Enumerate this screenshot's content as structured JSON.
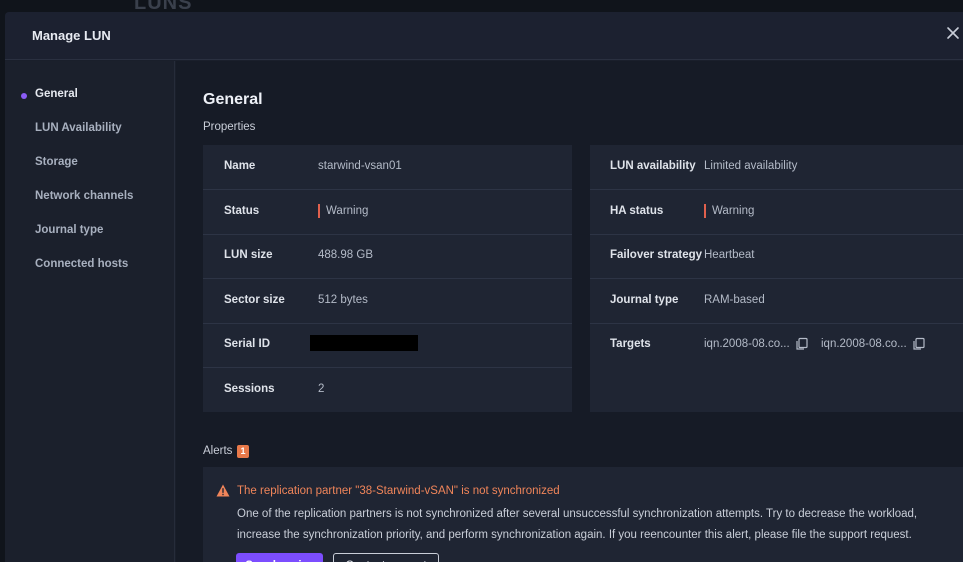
{
  "background": {
    "title": "LUNS"
  },
  "modal": {
    "title": "Manage LUN",
    "close_icon": "close-icon"
  },
  "sidebar": {
    "items": [
      {
        "label": "General",
        "active": true
      },
      {
        "label": "LUN Availability",
        "active": false
      },
      {
        "label": "Storage",
        "active": false
      },
      {
        "label": "Network channels",
        "active": false
      },
      {
        "label": "Journal type",
        "active": false
      },
      {
        "label": "Connected hosts",
        "active": false
      }
    ]
  },
  "general": {
    "heading": "General",
    "properties_label": "Properties",
    "left": [
      {
        "label": "Name",
        "value": "starwind-vsan01"
      },
      {
        "label": "Status",
        "value": "Warning"
      },
      {
        "label": "LUN size",
        "value": "488.98 GB"
      },
      {
        "label": "Sector size",
        "value": "512 bytes"
      },
      {
        "label": "Serial ID",
        "value": ""
      },
      {
        "label": "Sessions",
        "value": "2"
      }
    ],
    "right": [
      {
        "label": "LUN availability",
        "value": "Limited availability"
      },
      {
        "label": "HA status",
        "value": "Warning"
      },
      {
        "label": "Failover strategy",
        "value": "Heartbeat"
      },
      {
        "label": "Journal type",
        "value": "RAM-based"
      },
      {
        "label": "Targets",
        "value": ""
      }
    ],
    "targets": [
      "iqn.2008-08.co...",
      "iqn.2008-08.co..."
    ]
  },
  "alerts": {
    "label": "Alerts",
    "count": "1",
    "items": [
      {
        "title": "The replication partner \"38-Starwind-vSAN\" is not synchronized",
        "body": "One of the replication partners is not synchronized after several unsuccessful synchronization attempts. Try to decrease the workload, increase the synchronization priority, and perform synchronization again. If you reencounter this alert, please file the support request.",
        "primary_action": "Synchronize",
        "secondary_action": "Contact support"
      }
    ]
  },
  "colors": {
    "accent": "#7c4dff",
    "warning": "#e0604d",
    "alert_title": "#f0855a",
    "badge": "#e8794a"
  }
}
